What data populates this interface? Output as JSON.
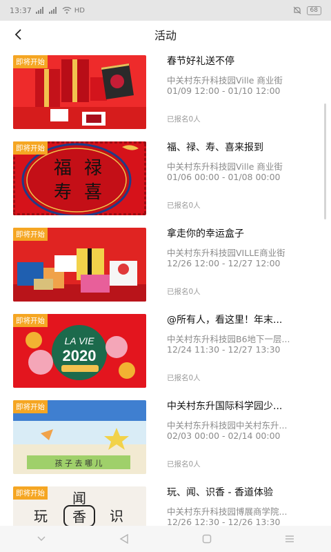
{
  "status_bar": {
    "time": "13:37",
    "network": "HD",
    "battery": "68"
  },
  "header": {
    "title": "活动",
    "back_icon": "chevron-left-icon"
  },
  "colors": {
    "badge": "#f5a623",
    "festive_red": "#d01419"
  },
  "events": [
    {
      "badge": "即将开始",
      "title": "春节好礼送不停",
      "location": "中关村东升科技园Ville 商业街",
      "time": "01/09 12:00 - 01/10 12:00",
      "registered": "已报名0人"
    },
    {
      "badge": "即将开始",
      "title": "福、禄、寿、喜来报到",
      "location": "中关村东升科技园Ville 商业街",
      "time": "01/06 00:00 - 01/08 00:00",
      "registered": "已报名0人",
      "image_text": [
        "福",
        "禄",
        "寿",
        "喜"
      ]
    },
    {
      "badge": "即将开始",
      "title": "拿走你的幸运盒子",
      "location": "中关村东升科技园VILLE商业街",
      "time": "12/26 12:00 - 12/27 12:00",
      "registered": "已报名0人"
    },
    {
      "badge": "即将开始",
      "title": "@所有人，看这里！年末...",
      "location": "中关村东升科技园B6地下一层...",
      "time": "12/24 11:30 - 12/27 13:30",
      "registered": "已报名0人",
      "image_text": [
        "LA VIE",
        "2020"
      ]
    },
    {
      "badge": "即将开始",
      "title": "中关村东升国际科学园少...",
      "location": "中关村东升科技园中关村东升...",
      "time": "02/03 00:00 - 02/14 00:00",
      "registered": "已报名0人",
      "image_text": [
        "孩 子 去 哪 儿"
      ]
    },
    {
      "badge": "即将开始",
      "title": "玩、闻、识香 - 香道体验",
      "location": "中关村东升科技园博展商学院...",
      "time": "12/26 12:30 - 12/26 13:30",
      "registered": "",
      "image_text": [
        "闻",
        "玩",
        "香",
        "识"
      ]
    }
  ],
  "nav": {
    "icons": [
      "chevron-down-icon",
      "back-triangle-icon",
      "home-square-icon",
      "menu-lines-icon"
    ]
  }
}
